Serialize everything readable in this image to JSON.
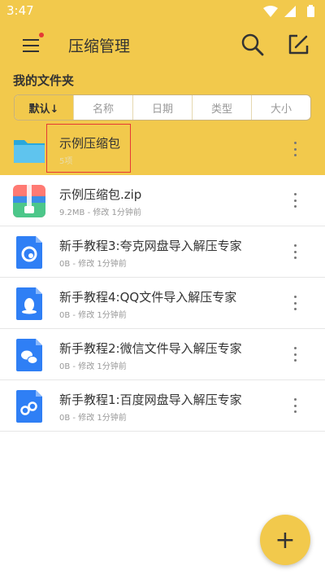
{
  "status": {
    "time": "3:47"
  },
  "app": {
    "title": "压缩管理"
  },
  "section": {
    "title": "我的文件夹"
  },
  "sort": {
    "tabs": [
      {
        "label": "默认↓",
        "active": true
      },
      {
        "label": "名称"
      },
      {
        "label": "日期"
      },
      {
        "label": "类型"
      },
      {
        "label": "大小"
      }
    ]
  },
  "files": [
    {
      "name": "示例压缩包",
      "meta": "5项",
      "icon": "folder-icon",
      "selected": true
    },
    {
      "name": "示例压缩包.zip",
      "meta": "9.2MB - 修改 1分钟前",
      "icon": "zip-file-icon"
    },
    {
      "name": "新手教程3:夸克网盘导入解压专家",
      "meta": "0B - 修改 1分钟前",
      "icon": "quark-doc-icon"
    },
    {
      "name": "新手教程4:QQ文件导入解压专家",
      "meta": "0B - 修改 1分钟前",
      "icon": "qq-doc-icon"
    },
    {
      "name": "新手教程2:微信文件导入解压专家",
      "meta": "0B - 修改 1分钟前",
      "icon": "wechat-doc-icon"
    },
    {
      "name": "新手教程1:百度网盘导入解压专家",
      "meta": "0B - 修改 1分钟前",
      "icon": "baidu-doc-icon"
    }
  ],
  "fab": {
    "label": "+"
  },
  "colors": {
    "accent": "#f2c94c",
    "highlight": "#e53935"
  }
}
